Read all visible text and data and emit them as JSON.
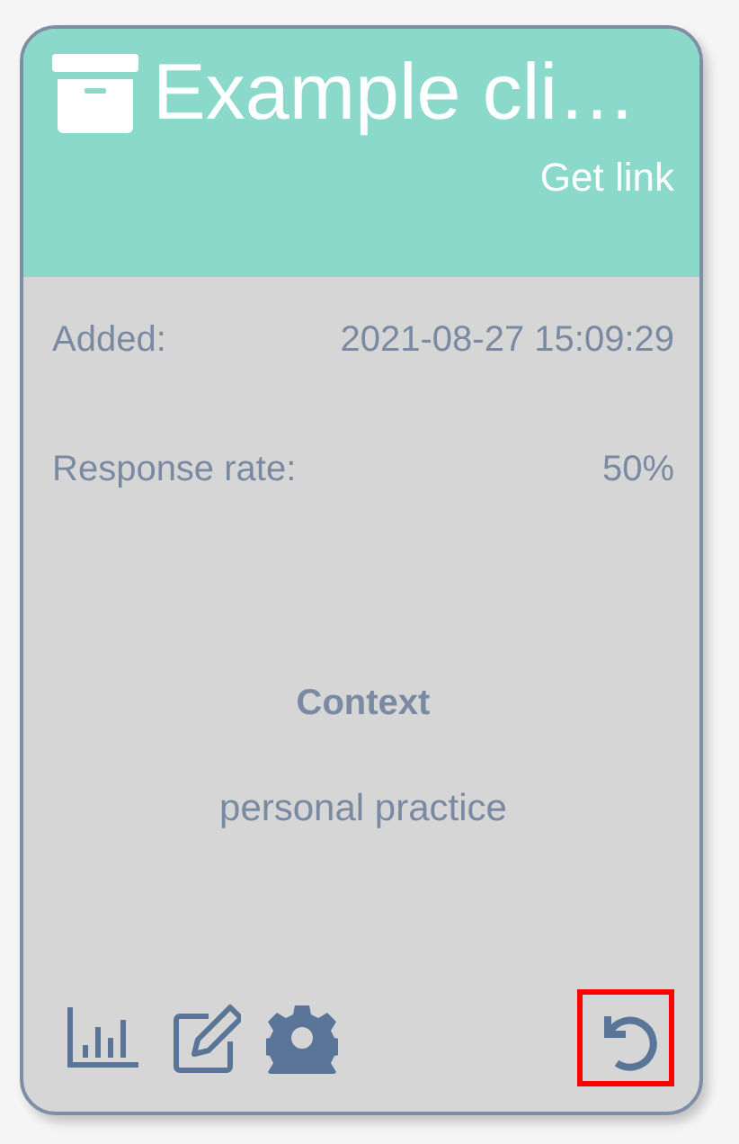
{
  "card": {
    "title": "Example cli…",
    "link": "Get link",
    "fields": [
      {
        "label": "Added:",
        "value": "2021-08-27 15:09:29"
      },
      {
        "label": "Response rate:",
        "value": "50%"
      }
    ],
    "context": {
      "heading": "Context",
      "text": "personal practice"
    },
    "actions": [
      {
        "kind": "stats",
        "highlighted": false
      },
      {
        "kind": "edit",
        "highlighted": false
      },
      {
        "kind": "settings",
        "highlighted": false
      },
      {
        "kind": "restore",
        "highlighted": true
      }
    ]
  }
}
